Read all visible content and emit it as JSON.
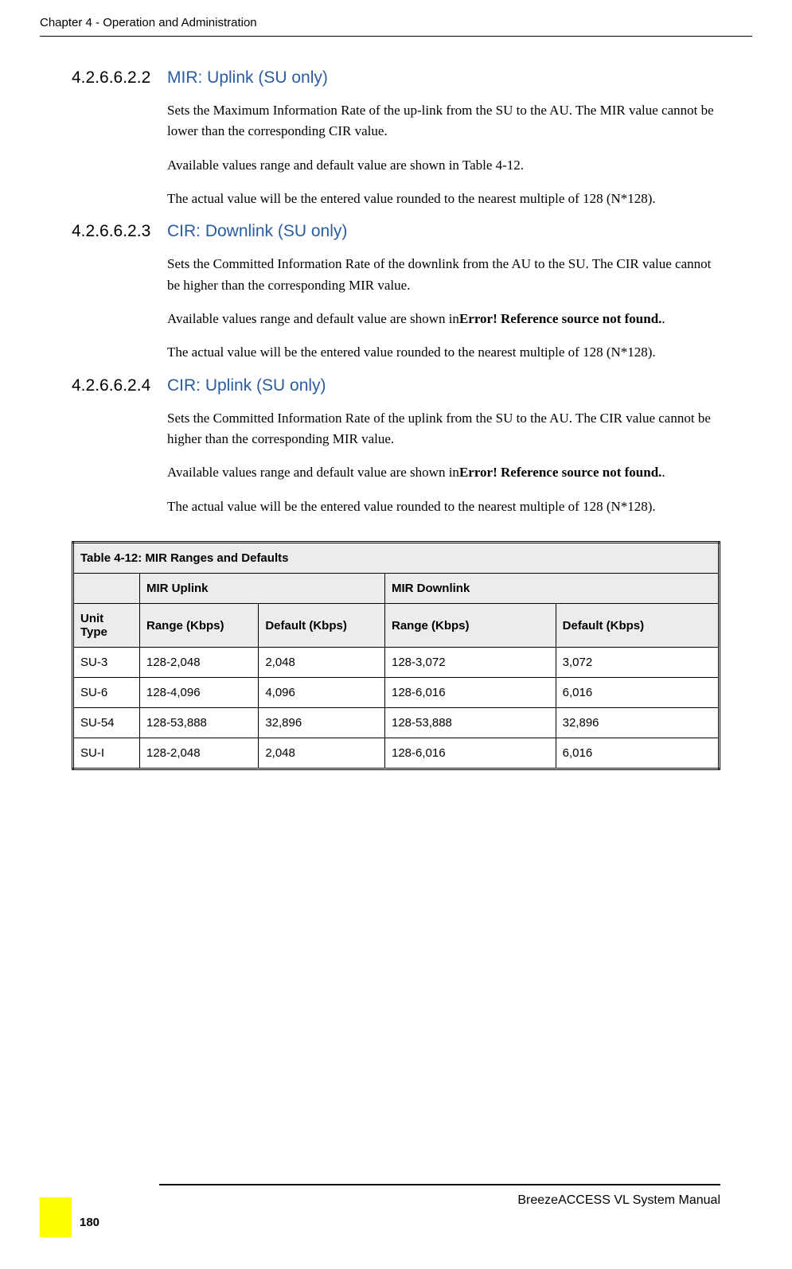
{
  "header": {
    "chapter": "Chapter 4 - Operation and Administration"
  },
  "sections": [
    {
      "number": "4.2.6.6.2.2",
      "title": "MIR: Uplink (SU only)",
      "paragraphs": [
        {
          "pre": "Sets the Maximum Information Rate of the up-link from the SU to the AU. The MIR value cannot be lower than the corresponding CIR value.",
          "bold": "",
          "post": ""
        },
        {
          "pre": "Available values range and default value are shown in Table 4-12.",
          "bold": "",
          "post": ""
        },
        {
          "pre": "The actual value will be the entered value rounded to the nearest multiple of 128 (N*128).",
          "bold": "",
          "post": ""
        }
      ]
    },
    {
      "number": "4.2.6.6.2.3",
      "title": "CIR: Downlink (SU only)",
      "paragraphs": [
        {
          "pre": "Sets the Committed Information Rate of the downlink from the AU to the SU. The CIR value cannot be higher than the corresponding MIR value.",
          "bold": "",
          "post": ""
        },
        {
          "pre": "Available values range and default value are shown in",
          "bold": "Error! Reference source not found.",
          "post": "."
        },
        {
          "pre": "The actual value will be the entered value rounded to the nearest multiple of 128 (N*128).",
          "bold": "",
          "post": ""
        }
      ]
    },
    {
      "number": "4.2.6.6.2.4",
      "title": "CIR: Uplink (SU only)",
      "paragraphs": [
        {
          "pre": "Sets the Committed Information Rate of the uplink from the SU to the AU. The CIR value cannot be higher than the corresponding MIR value.",
          "bold": "",
          "post": ""
        },
        {
          "pre": "Available values range and default value are shown in",
          "bold": "Error! Reference source not found.",
          "post": "."
        },
        {
          "pre": "The actual value will be the entered value rounded to the nearest multiple of 128 (N*128).",
          "bold": "",
          "post": ""
        }
      ]
    }
  ],
  "table": {
    "caption": "Table 4-12: MIR Ranges and Defaults",
    "group_headers": [
      "",
      "MIR Uplink",
      "MIR Downlink"
    ],
    "col_headers": [
      "Unit Type",
      "Range (Kbps)",
      "Default (Kbps)",
      "Range (Kbps)",
      "Default (Kbps)"
    ],
    "rows": [
      [
        "SU-3",
        "128-2,048",
        "2,048",
        "128-3,072",
        "3,072"
      ],
      [
        "SU-6",
        "128-4,096",
        "4,096",
        "128-6,016",
        "6,016"
      ],
      [
        "SU-54",
        "128-53,888",
        "32,896",
        "128-53,888",
        "32,896"
      ],
      [
        "SU-I",
        "128-2,048",
        "2,048",
        "128-6,016",
        "6,016"
      ]
    ]
  },
  "footer": {
    "manual_name": "BreezeACCESS VL System Manual",
    "page_number": "180"
  }
}
